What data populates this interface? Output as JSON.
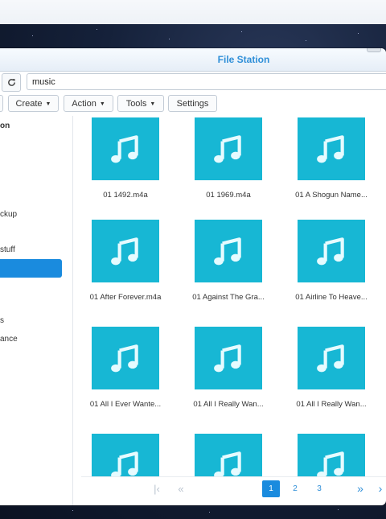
{
  "window": {
    "title": "File Station"
  },
  "path": {
    "value": "music"
  },
  "toolbar": {
    "create_label": "Create",
    "action_label": "Action",
    "tools_label": "Tools",
    "settings_label": "Settings"
  },
  "sidebar": {
    "header": "on",
    "items": [
      {
        "label": "ckup"
      },
      {
        "label": "stuff"
      },
      {
        "label": "s"
      },
      {
        "label": "ance"
      }
    ]
  },
  "files": [
    {
      "name": "01 1492.m4a"
    },
    {
      "name": "01 1969.m4a"
    },
    {
      "name": "01 A Shogun Name..."
    },
    {
      "name": "01 After Forever.m4a"
    },
    {
      "name": "01 Against The Gra..."
    },
    {
      "name": "01 Airline To Heave..."
    },
    {
      "name": "01 All I Ever Wante..."
    },
    {
      "name": "01 All I Really Wan..."
    },
    {
      "name": "01 All I Really Wan..."
    }
  ],
  "pagination": {
    "pages": [
      "1",
      "2",
      "3"
    ],
    "current": "1"
  },
  "colors": {
    "accent": "#1a8bde",
    "thumbnail": "#17b7d4",
    "title": "#2f8fd8"
  }
}
